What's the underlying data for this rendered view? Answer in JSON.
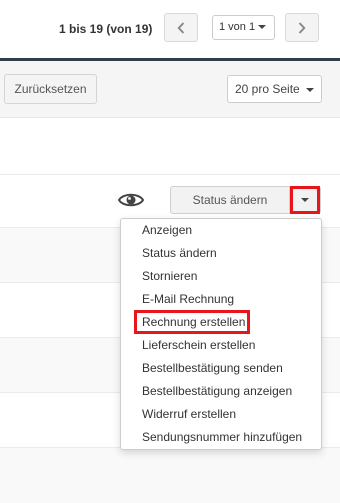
{
  "pagination": {
    "info": "1 bis 19 (von 19)",
    "prev_icon": "chevron-left-icon",
    "page_select": "1 von 1",
    "next_icon": "chevron-right-icon"
  },
  "filters": {
    "reset_label": "Zurücksetzen",
    "per_page": "20 pro Seite"
  },
  "order_actions": {
    "view_icon": "eye-icon",
    "status_button": "Status ändern",
    "toggle_icon": "caret-down-icon"
  },
  "menu": {
    "items": [
      "Anzeigen",
      "Status ändern",
      "Stornieren",
      "E-Mail Rechnung",
      "Rechnung erstellen",
      "Lieferschein erstellen",
      "Bestellbestätigung senden",
      "Bestellbestätigung anzeigen",
      "Widerruf erstellen",
      "Sendungsnummer hinzufügen"
    ]
  },
  "colors": {
    "highlight": "#e8151b",
    "header_divider": "#2f3e4a"
  }
}
